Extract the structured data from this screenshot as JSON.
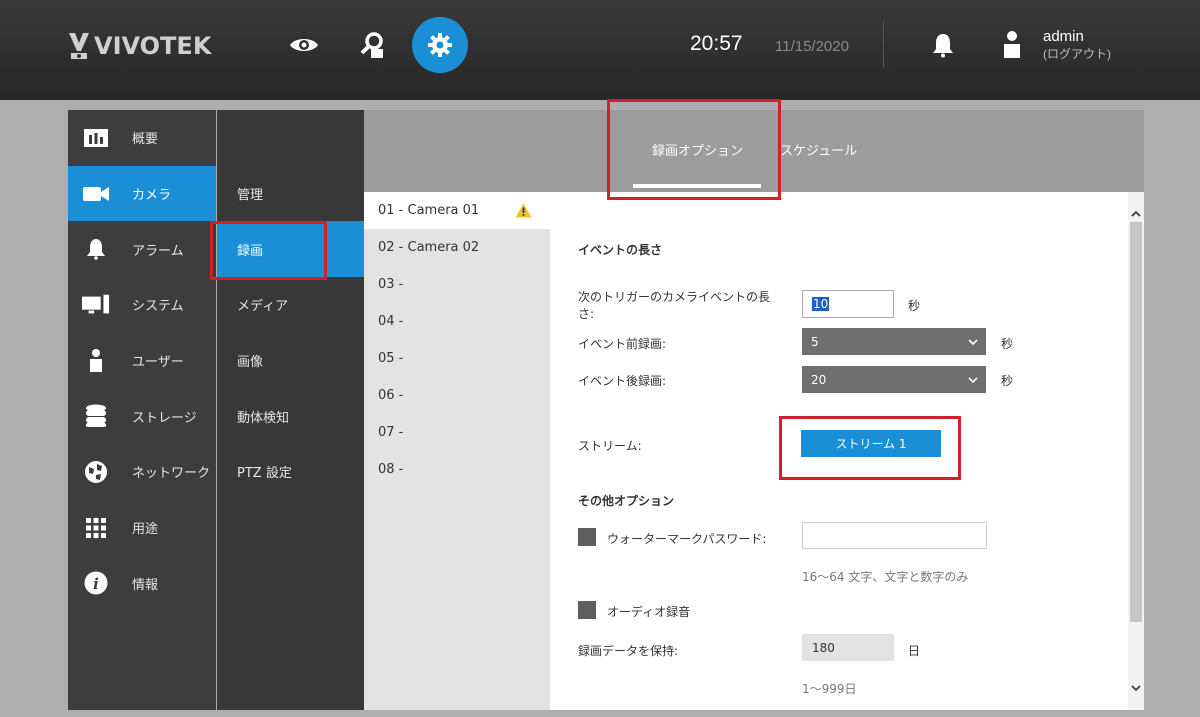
{
  "header": {
    "logo_text": "VIVOTEK",
    "time": "20:57",
    "date": "11/15/2020",
    "username": "admin",
    "logout_label": "(ログアウト)",
    "active_mode": "settings",
    "accent_color": "#1a8fd6"
  },
  "nav_primary": {
    "items": [
      {
        "label": "概要",
        "icon": "overview-icon"
      },
      {
        "label": "カメラ",
        "icon": "camera-icon",
        "active": true
      },
      {
        "label": "アラーム",
        "icon": "bell-icon"
      },
      {
        "label": "システム",
        "icon": "system-icon"
      },
      {
        "label": "ユーザー",
        "icon": "user-icon"
      },
      {
        "label": "ストレージ",
        "icon": "storage-icon"
      },
      {
        "label": "ネットワーク",
        "icon": "network-icon"
      },
      {
        "label": "用途",
        "icon": "apps-icon"
      },
      {
        "label": "情報",
        "icon": "info-icon"
      }
    ]
  },
  "nav_secondary": {
    "items": [
      {
        "label": "管理"
      },
      {
        "label": "録画",
        "active": true
      },
      {
        "label": "メディア"
      },
      {
        "label": "画像"
      },
      {
        "label": "動体検知"
      },
      {
        "label": "PTZ 設定"
      }
    ]
  },
  "tabs": [
    {
      "label": "録画オプション",
      "active": true
    },
    {
      "label": "スケジュール"
    }
  ],
  "cameras": [
    {
      "label": "01 - Camera 01",
      "warning": true,
      "active": true
    },
    {
      "label": "02 - Camera 02"
    },
    {
      "label": "03 -"
    },
    {
      "label": "04 -"
    },
    {
      "label": "05 -"
    },
    {
      "label": "06 -"
    },
    {
      "label": "07 -"
    },
    {
      "label": "08 -"
    }
  ],
  "form": {
    "event_length_title": "イベントの長さ",
    "next_trigger_label_line1": "次のトリガーのカメライベントの長",
    "next_trigger_label_line2": "さ:",
    "next_trigger_value": "10",
    "next_trigger_unit": "秒",
    "pre_record_label": "イベント前録画:",
    "pre_record_value": "5",
    "pre_record_unit": "秒",
    "post_record_label": "イベント後録画:",
    "post_record_value": "20",
    "post_record_unit": "秒",
    "stream_label": "ストリーム:",
    "stream_button": "ストリーム 1",
    "other_options_title": "その他オプション",
    "watermark_label": "ウォーターマークパスワード:",
    "watermark_value": "",
    "watermark_hint": "16～64 文字、文字と数字のみ",
    "audio_label": "オーディオ録音",
    "retention_label": "録画データを保持:",
    "retention_value": "180",
    "retention_unit": "日",
    "retention_hint": "1～999日"
  }
}
